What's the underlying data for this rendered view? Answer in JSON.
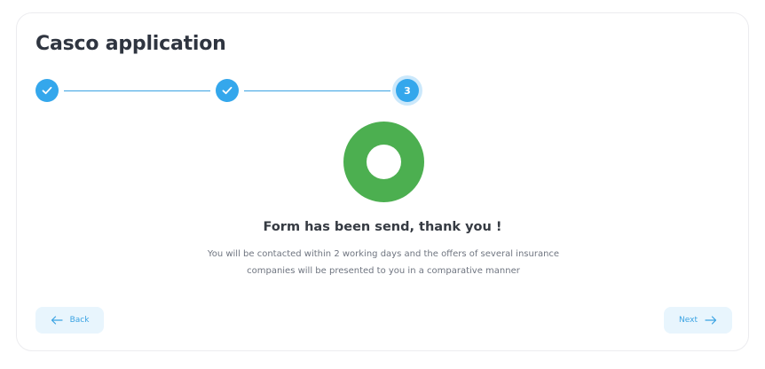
{
  "page": {
    "title": "Casco application"
  },
  "stepper": {
    "steps": [
      {
        "state": "completed",
        "icon": "check-icon"
      },
      {
        "state": "completed",
        "icon": "check-icon"
      },
      {
        "state": "active",
        "label": "3"
      }
    ],
    "accent_color": "#34a7ec"
  },
  "confirmation": {
    "icon": "success-ring-icon",
    "icon_color": "#4caf50",
    "headline": "Form has been send, thank you !",
    "message": "You will be contacted within 2 working days and the offers of several insurance companies will be presented to you in a comparative manner"
  },
  "navigation": {
    "back_label": "Back",
    "back_icon": "arrow-left-icon",
    "next_label": "Next",
    "next_icon": "arrow-right-icon"
  }
}
